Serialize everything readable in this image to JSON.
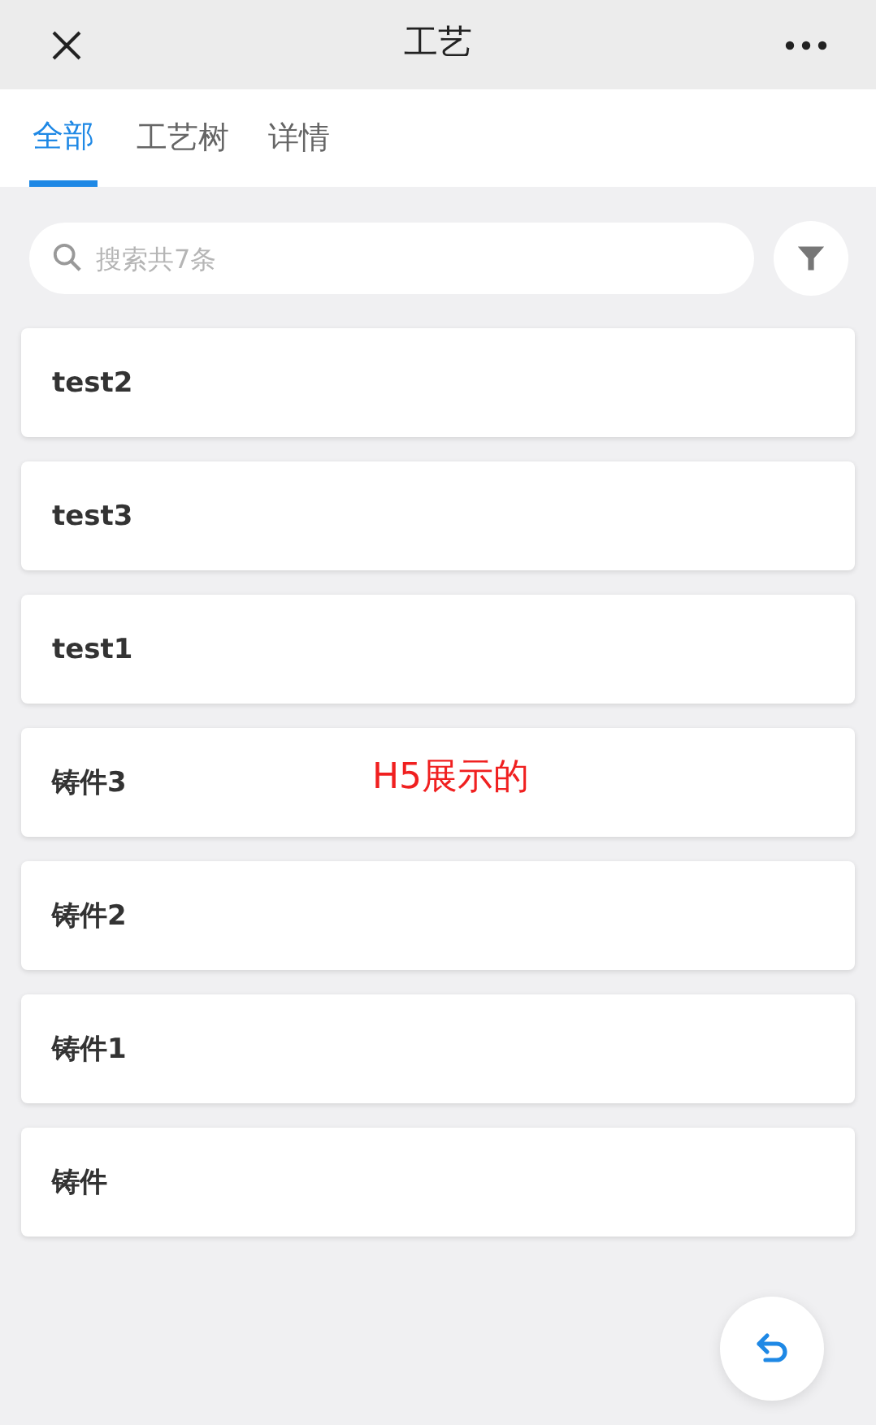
{
  "header": {
    "title": "工艺"
  },
  "tabs": [
    {
      "label": "全部",
      "selected": true
    },
    {
      "label": "工艺树",
      "selected": false
    },
    {
      "label": "详情",
      "selected": false
    }
  ],
  "search": {
    "placeholder": "搜索共7条"
  },
  "items": [
    {
      "name": "test2"
    },
    {
      "name": "test3"
    },
    {
      "name": "test1"
    },
    {
      "name": "铸件3"
    },
    {
      "name": "铸件2"
    },
    {
      "name": "铸件1"
    },
    {
      "name": "铸件"
    }
  ],
  "annotation": {
    "text": "H5展示的"
  }
}
